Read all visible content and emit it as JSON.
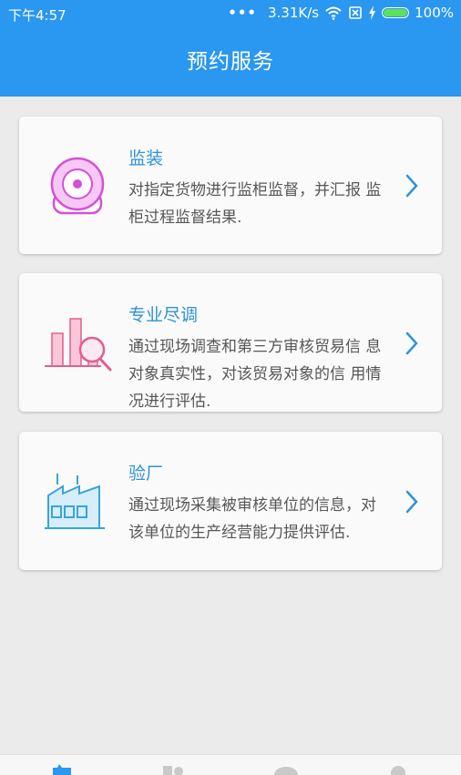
{
  "status_bar": {
    "time": "下午4:57",
    "network_speed": "3.31K/s",
    "battery_percent": "100%",
    "battery_level": 1.0
  },
  "header": {
    "title": "预约服务"
  },
  "services": [
    {
      "title": "监装",
      "description": "对指定货物进行监柜监督，并汇报 监柜过程监督结果.",
      "icon": "camera-icon"
    },
    {
      "title": "专业尽调",
      "description": "通过现场调查和第三方审核贸易信 息对象真实性，对该贸易对象的信 用情况进行评估.",
      "icon": "chart-search-icon"
    },
    {
      "title": "验厂",
      "description": "通过现场采集被审核单位的信息，对该单位的生产经营能力提供评估.",
      "icon": "factory-icon"
    }
  ],
  "colors": {
    "header_bg": "#2a97f1",
    "accent": "#2e93d8",
    "camera_icon": "#d54fd7",
    "chart_icon": "#e35e8e",
    "factory_icon": "#3aa3dc"
  },
  "bottom_nav": [
    "home-tab-icon",
    "orders-tab-icon",
    "message-tab-icon",
    "profile-tab-icon"
  ]
}
